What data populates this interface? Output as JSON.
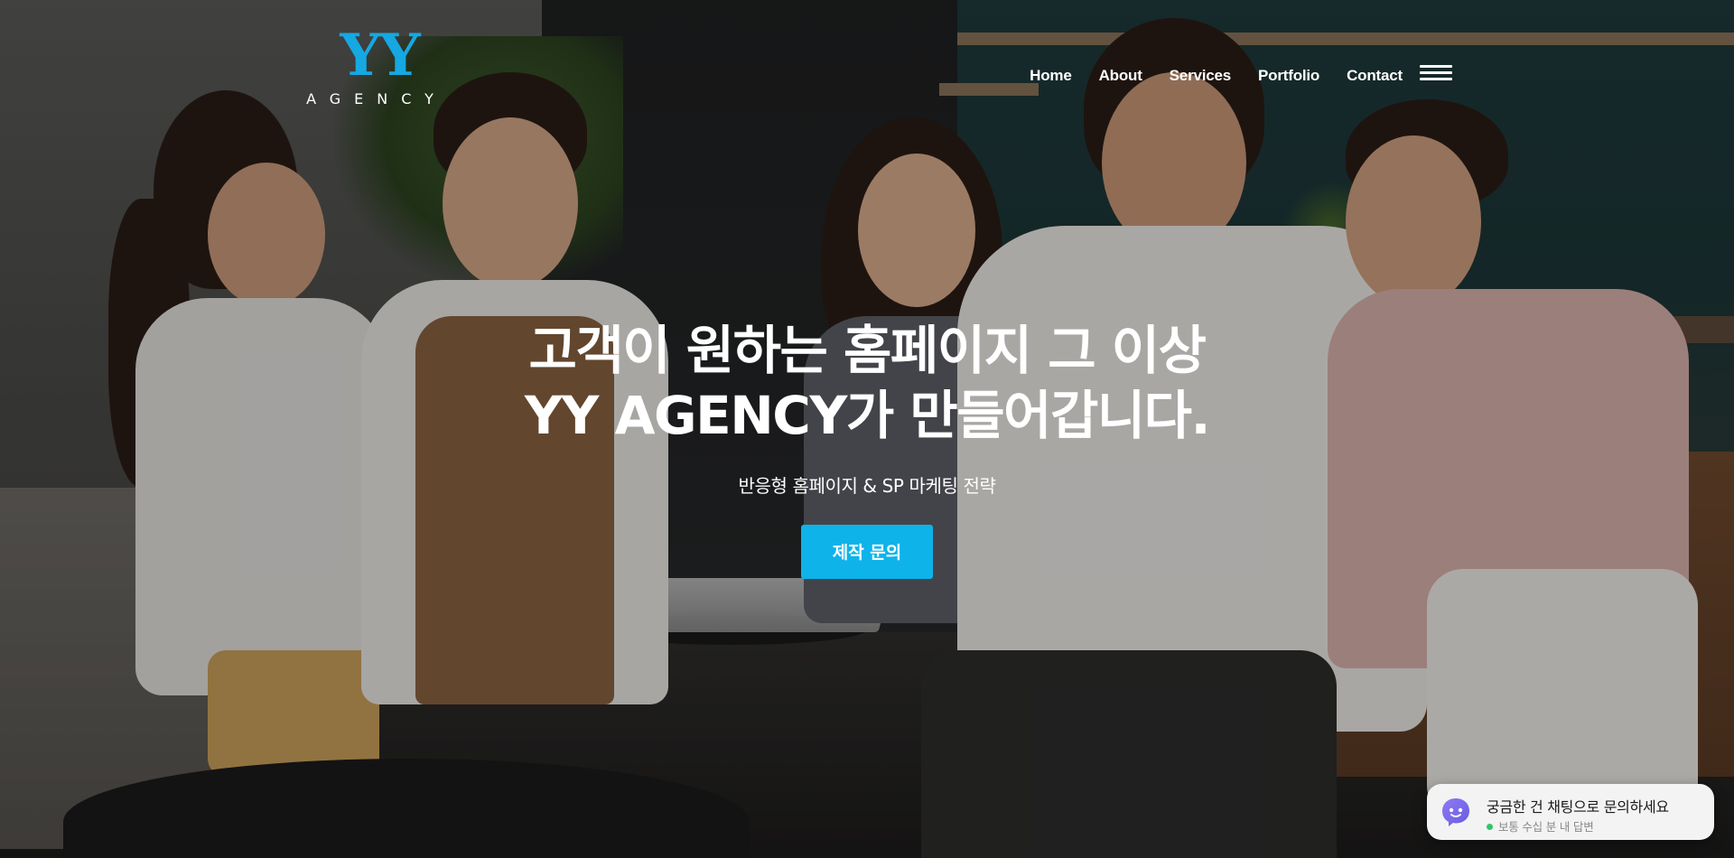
{
  "header": {
    "logo_mark": "YY",
    "logo_sub": "AGENCY",
    "nav": [
      "Home",
      "About",
      "Services",
      "Portfolio",
      "Contact"
    ],
    "menu_icon": "hamburger-icon"
  },
  "hero": {
    "title_line1": "고객이 원하는 홈페이지 그 이상",
    "title_line2": "YY AGENCY가 만들어갑니다.",
    "subtitle": "반응형 홈페이지 & SP 마케팅 전략",
    "cta_label": "제작 문의",
    "background": "office-team-photo"
  },
  "chat_widget": {
    "title": "궁금한 건 채팅으로 문의하세요",
    "status": "보통 수십 분 내 답변",
    "icon": "chat-bot-icon",
    "status_color": "#35c46a"
  },
  "colors": {
    "accent": "#0eb3ea",
    "logo": "#16a8e2"
  }
}
